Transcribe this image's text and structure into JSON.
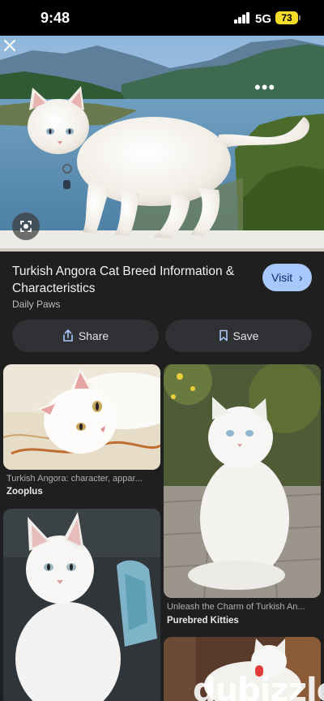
{
  "status": {
    "time": "9:48",
    "network": "5G",
    "battery": "73"
  },
  "hero": {
    "image_icon": "turkish-angora-cat-photo",
    "more_icon": "more-horiz-icon",
    "close_icon": "close-icon",
    "lens_icon": "lens-search-icon"
  },
  "result": {
    "title": "Turkish Angora Cat Breed Information & Characteristics",
    "source": "Daily Paws",
    "visit_label": "Visit",
    "visit_chevron": "›"
  },
  "actions": {
    "share_label": "Share",
    "save_label": "Save"
  },
  "related": [
    {
      "caption": "Turkish Angora: character, appar...",
      "source": "Zooplus"
    },
    {
      "caption": "Unleash the Charm of Turkish An...",
      "source": "Purebred Kitties"
    },
    {
      "caption": "",
      "source": ""
    },
    {
      "caption": "",
      "source": ""
    }
  ],
  "watermark": {
    "text": "dubizzle"
  },
  "colors": {
    "background": "#1f1f1f",
    "button": "#303134",
    "visit_bg": "#a8c7fa",
    "visit_text": "#062e6f",
    "battery": "#f4dd2a"
  }
}
